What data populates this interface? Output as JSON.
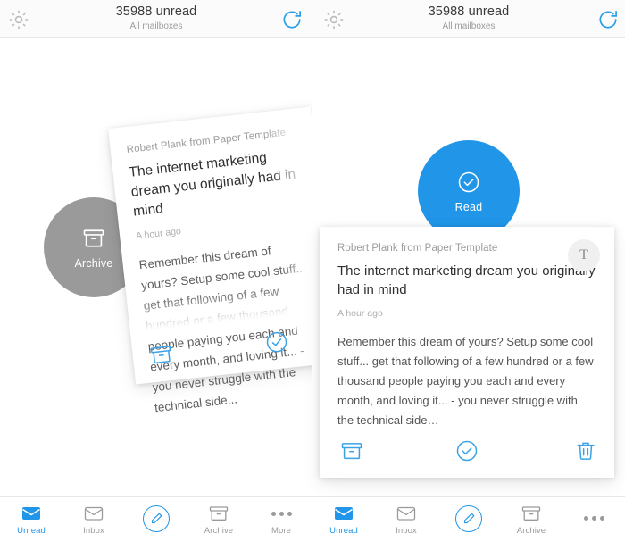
{
  "panes": [
    {
      "id": "left",
      "header": {
        "unread": "35988 unread",
        "mailboxes": "All mailboxes",
        "gear_icon": "gear-icon",
        "refresh_icon": "refresh-icon"
      },
      "swipe_circle": {
        "label": "Archive",
        "icon": "archive-box-icon",
        "color": "#9a9a9a"
      },
      "card": {
        "sender": "Robert Plank from Paper Template",
        "subject": "The internet marketing dream you originally had in mind",
        "time": "A hour ago",
        "preview": "Remember this dream of yours? Setup some cool stuff... get that following of a few hundred or a few thousand people paying you each and every month, and loving it... - you never struggle with the technical side...",
        "actions": [
          {
            "name": "archive-icon",
            "label": "Archive"
          },
          {
            "name": "mark-read-icon",
            "label": "Mark read"
          }
        ]
      }
    },
    {
      "id": "right",
      "header": {
        "unread": "35988 unread",
        "mailboxes": "All mailboxes",
        "gear_icon": "gear-icon",
        "refresh_icon": "refresh-icon"
      },
      "swipe_circle": {
        "label": "Read",
        "icon": "check-circle-icon",
        "color": "#2196e8"
      },
      "card": {
        "sender": "Robert Plank from Paper Template",
        "subject": "The internet marketing dream you originally had in mind",
        "time": "A hour ago",
        "preview": "Remember this dream of yours? Setup some cool stuff... get that following of a few hundred or a few thousand people paying you each and every month, and loving it... - you never struggle with the technical side…",
        "avatar_initial": "T",
        "actions": [
          {
            "name": "archive-icon",
            "label": "Archive"
          },
          {
            "name": "mark-read-icon",
            "label": "Mark read"
          },
          {
            "name": "trash-icon",
            "label": "Delete"
          }
        ]
      }
    }
  ],
  "tabbar_left": {
    "items": [
      {
        "label": "Unread",
        "icon": "unread-mail-icon",
        "active": true
      },
      {
        "label": "Inbox",
        "icon": "inbox-envelope-icon",
        "active": false
      },
      {
        "label": "",
        "icon": "compose-pencil-icon",
        "active": false
      },
      {
        "label": "Archive",
        "icon": "archive-box-icon",
        "active": false
      },
      {
        "label": "More",
        "icon": "more-dots-icon",
        "active": false
      }
    ]
  },
  "tabbar_right": {
    "items": [
      {
        "label": "Unread",
        "icon": "unread-mail-icon",
        "active": true
      },
      {
        "label": "Inbox",
        "icon": "inbox-envelope-icon",
        "active": false
      },
      {
        "label": "",
        "icon": "compose-pencil-icon",
        "active": false
      },
      {
        "label": "Archive",
        "icon": "archive-box-icon",
        "active": false
      },
      {
        "label": "",
        "icon": "more-dots-icon",
        "active": false
      }
    ]
  },
  "colors": {
    "accent": "#2196e8",
    "archive_gray": "#9a9a9a",
    "text_primary": "#2f2f2f",
    "text_muted": "#9c9c9c"
  }
}
